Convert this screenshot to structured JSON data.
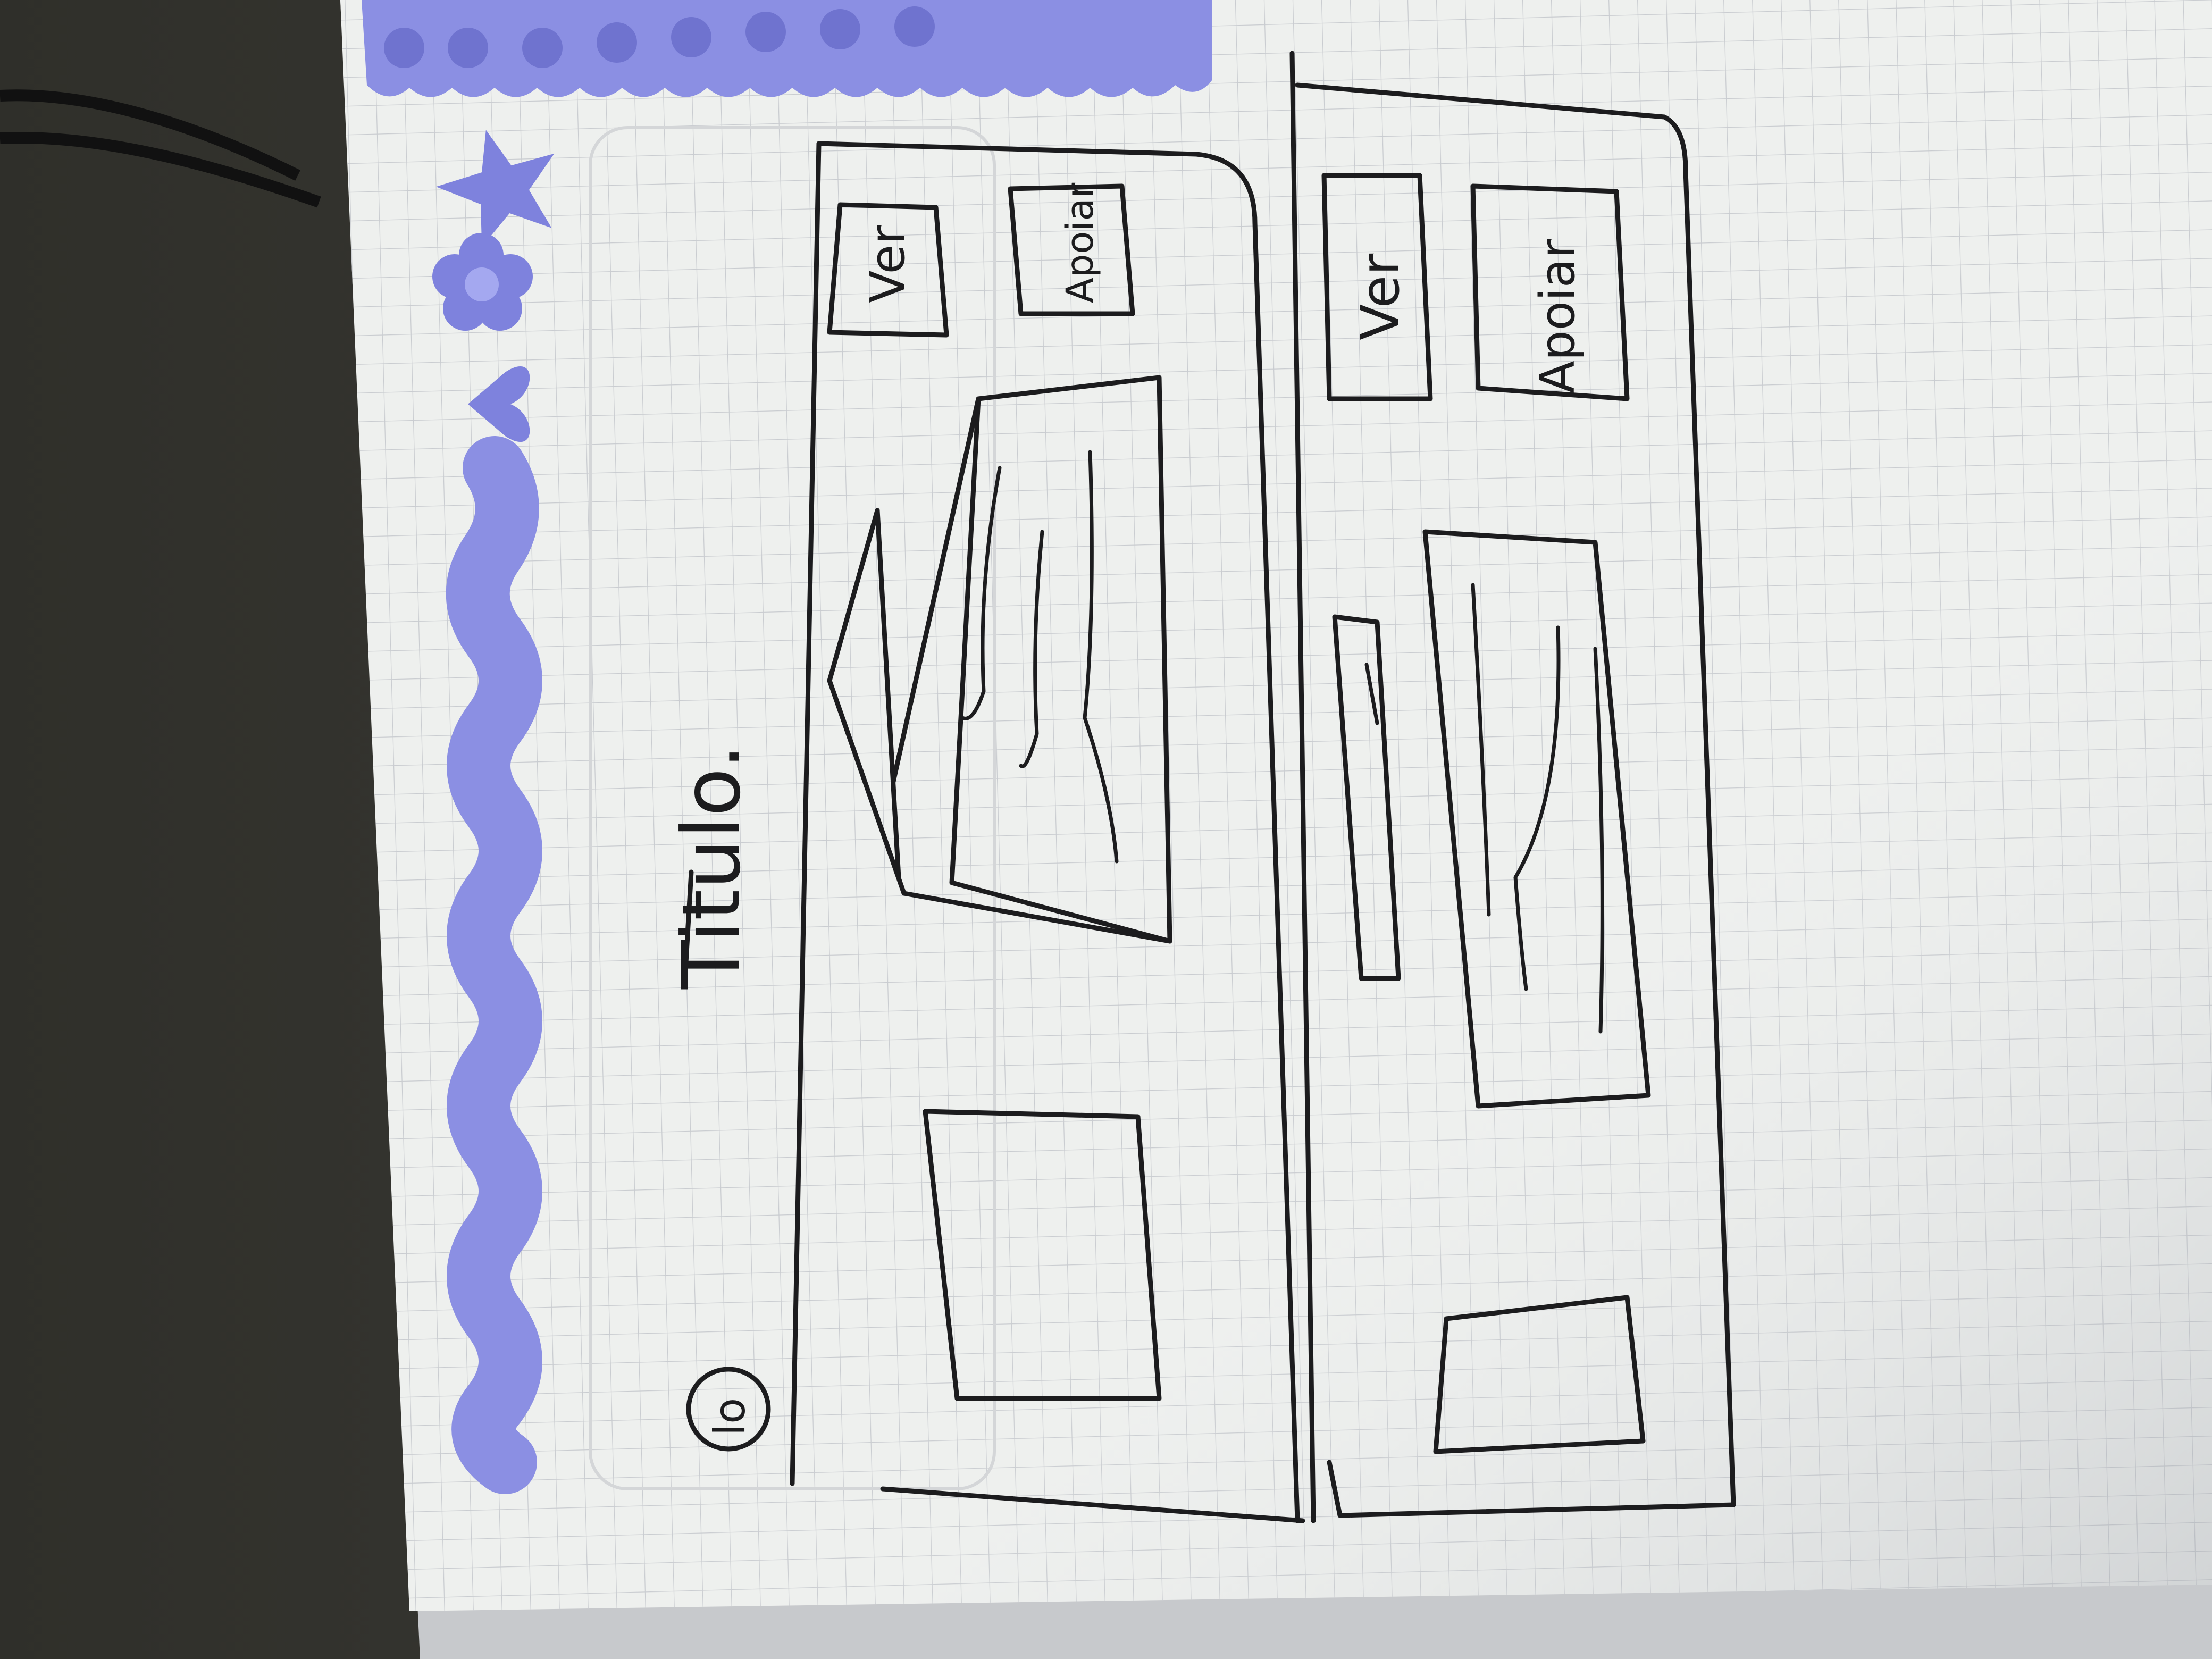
{
  "sketch": {
    "title": "Titulo.",
    "logo_text": "lo",
    "panel_top": {
      "button_primary": "Ver",
      "button_secondary": "Apoiar"
    },
    "panel_bottom": {
      "button_primary": "Ver",
      "button_secondary": "Apoiar"
    }
  },
  "colors": {
    "paper": "#f2f3f1",
    "grid": "#c9ccd0",
    "sticker_lavender": "#8b8fe3",
    "ink": "#1c1c1e",
    "background_dark": "#3b3a35"
  },
  "icons": [
    "star-icon",
    "flower-icon",
    "heart-icon"
  ]
}
